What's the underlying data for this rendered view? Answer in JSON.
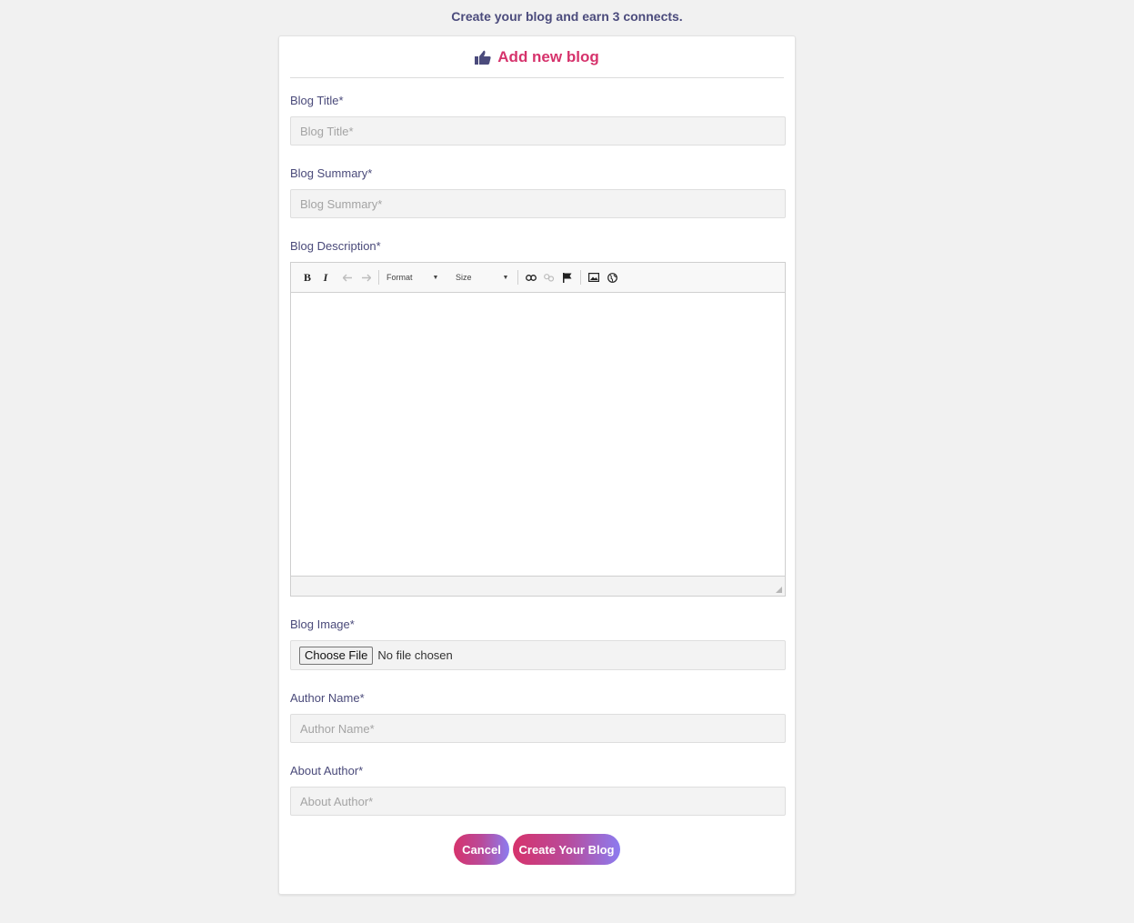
{
  "banner": "Create your blog and earn 3 connects.",
  "card": {
    "title": "Add new blog",
    "title_icon": "thumbs-up-icon"
  },
  "fields": {
    "title": {
      "label": "Blog Title*",
      "placeholder": "Blog Title*",
      "value": ""
    },
    "summary": {
      "label": "Blog Summary*",
      "placeholder": "Blog Summary*",
      "value": ""
    },
    "description": {
      "label": "Blog Description*",
      "value": ""
    },
    "image": {
      "label": "Blog Image*",
      "button_label": "Choose File",
      "status": "No file chosen"
    },
    "author_name": {
      "label": "Author Name*",
      "placeholder": "Author Name*",
      "value": ""
    },
    "about_author": {
      "label": "About Author*",
      "placeholder": "About Author*",
      "value": ""
    }
  },
  "editor_toolbar": {
    "bold": "B",
    "italic": "I",
    "format_label": "Format",
    "size_label": "Size",
    "icons": [
      "bold-icon",
      "italic-icon",
      "undo-icon",
      "redo-icon",
      "link-icon",
      "unlink-icon",
      "anchor-flag-icon",
      "image-icon",
      "iframe-globe-icon"
    ]
  },
  "actions": {
    "cancel_label": "Cancel",
    "create_label": "Create Your Blog"
  },
  "colors": {
    "accent": "#d6336c",
    "gradient_end": "#8c7cf0",
    "label": "#4a4a7a",
    "background": "#f1f1f1"
  }
}
